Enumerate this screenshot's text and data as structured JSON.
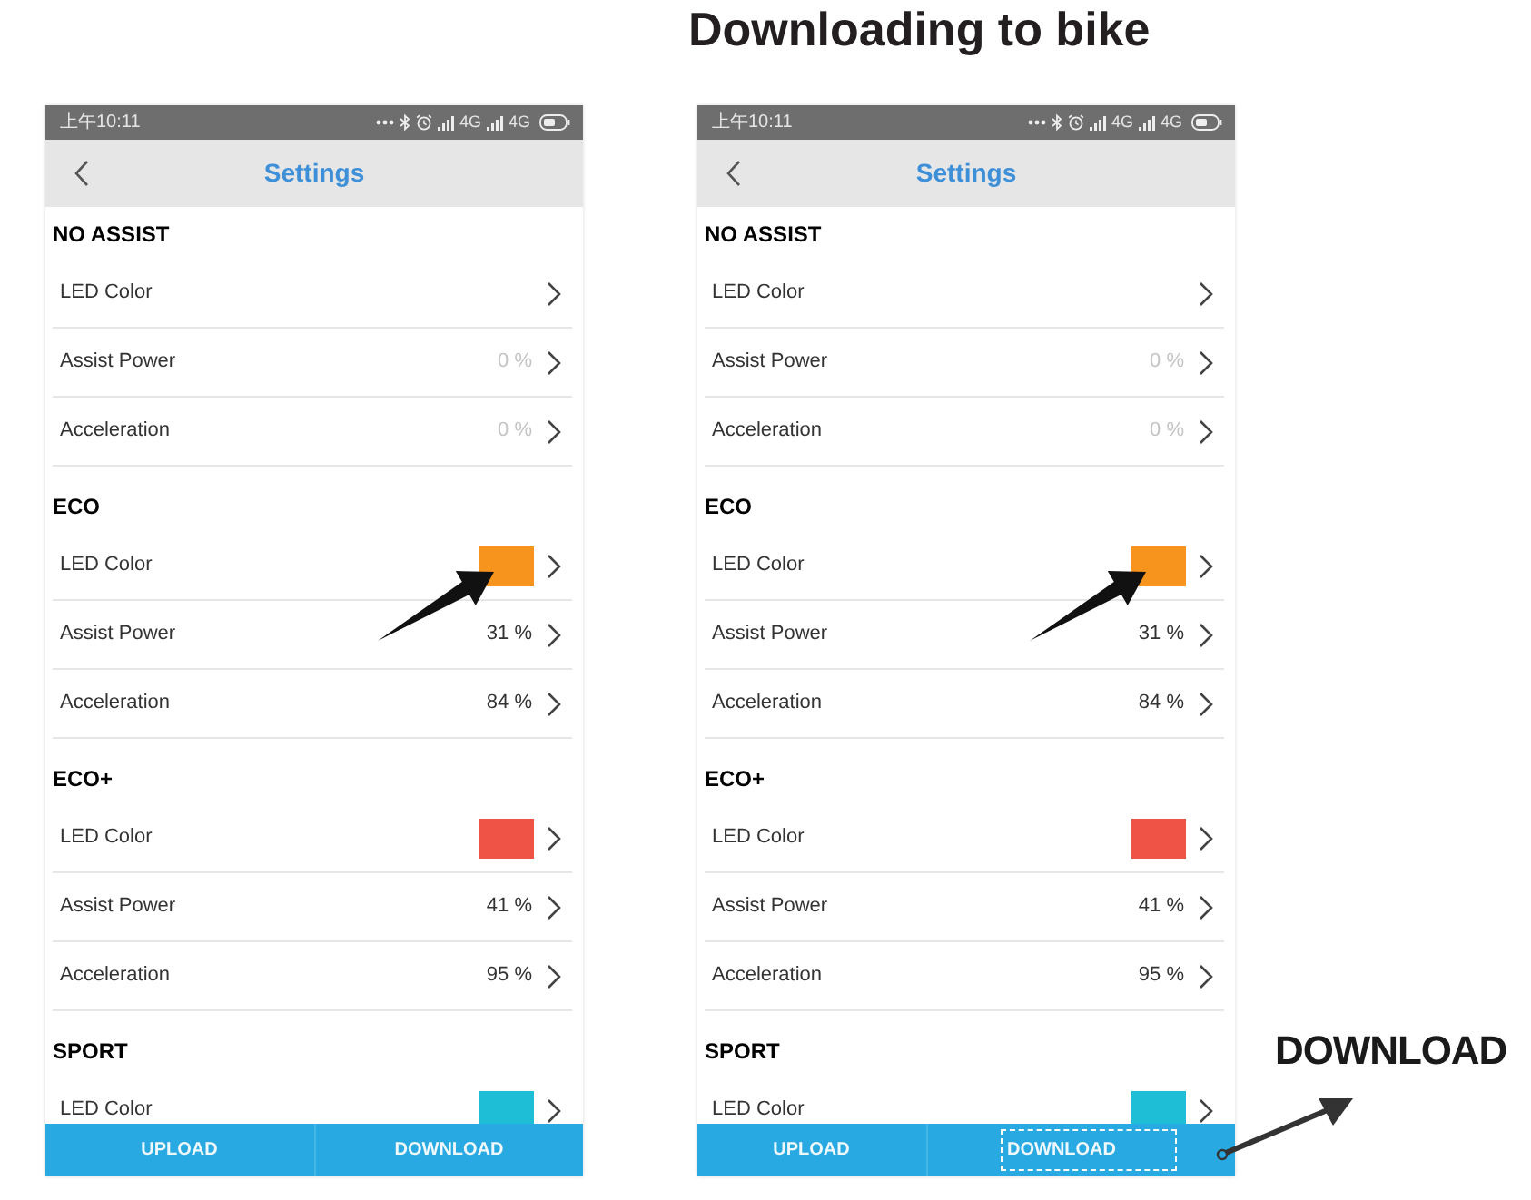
{
  "title": "Downloading to bike",
  "phones": [
    {
      "status_bar": {
        "time": "上午10:11",
        "network_1": "4G",
        "network_2": "4G"
      },
      "header": {
        "title": "Settings"
      },
      "sections": [
        {
          "title": "NO ASSIST",
          "rows": [
            {
              "kind": "color",
              "label": "LED Color"
            },
            {
              "kind": "value",
              "label": "Assist Power",
              "value": "0 %",
              "disabled": true
            },
            {
              "kind": "value",
              "label": "Acceleration",
              "value": "0 %",
              "disabled": true
            }
          ]
        },
        {
          "title": "ECO",
          "rows": [
            {
              "kind": "color",
              "label": "LED Color",
              "color": "#f7941d"
            },
            {
              "kind": "value",
              "label": "Assist Power",
              "value": "31 %",
              "disabled": false
            },
            {
              "kind": "value",
              "label": "Acceleration",
              "value": "84 %",
              "disabled": false
            }
          ]
        },
        {
          "title": "ECO+",
          "rows": [
            {
              "kind": "color",
              "label": "LED Color",
              "color": "#ef5346"
            },
            {
              "kind": "value",
              "label": "Assist Power",
              "value": "41 %",
              "disabled": false
            },
            {
              "kind": "value",
              "label": "Acceleration",
              "value": "95 %",
              "disabled": false
            }
          ]
        },
        {
          "title": "SPORT",
          "rows": [
            {
              "kind": "color",
              "label": "LED Color",
              "color": "#1ebfd6"
            }
          ]
        }
      ],
      "bottom_bar": {
        "buttons": [
          {
            "label": "UPLOAD",
            "highlighted": false
          },
          {
            "label": "DOWNLOAD",
            "highlighted": false
          }
        ]
      }
    },
    {
      "status_bar": {
        "time": "上午10:11",
        "network_1": "4G",
        "network_2": "4G"
      },
      "header": {
        "title": "Settings"
      },
      "sections": [
        {
          "title": "NO ASSIST",
          "rows": [
            {
              "kind": "color",
              "label": "LED Color"
            },
            {
              "kind": "value",
              "label": "Assist Power",
              "value": "0 %",
              "disabled": true
            },
            {
              "kind": "value",
              "label": "Acceleration",
              "value": "0 %",
              "disabled": true
            }
          ]
        },
        {
          "title": "ECO",
          "rows": [
            {
              "kind": "color",
              "label": "LED Color",
              "color": "#f7941d"
            },
            {
              "kind": "value",
              "label": "Assist Power",
              "value": "31 %",
              "disabled": false
            },
            {
              "kind": "value",
              "label": "Acceleration",
              "value": "84 %",
              "disabled": false
            }
          ]
        },
        {
          "title": "ECO+",
          "rows": [
            {
              "kind": "color",
              "label": "LED Color",
              "color": "#ef5346"
            },
            {
              "kind": "value",
              "label": "Assist Power",
              "value": "41 %",
              "disabled": false
            },
            {
              "kind": "value",
              "label": "Acceleration",
              "value": "95 %",
              "disabled": false
            }
          ]
        },
        {
          "title": "SPORT",
          "rows": [
            {
              "kind": "color",
              "label": "LED Color",
              "color": "#1ebfd6"
            }
          ]
        }
      ],
      "bottom_bar": {
        "buttons": [
          {
            "label": "UPLOAD",
            "highlighted": false
          },
          {
            "label": "DOWNLOAD",
            "highlighted": true
          }
        ]
      }
    }
  ],
  "callout": {
    "label": "DOWNLOAD"
  }
}
